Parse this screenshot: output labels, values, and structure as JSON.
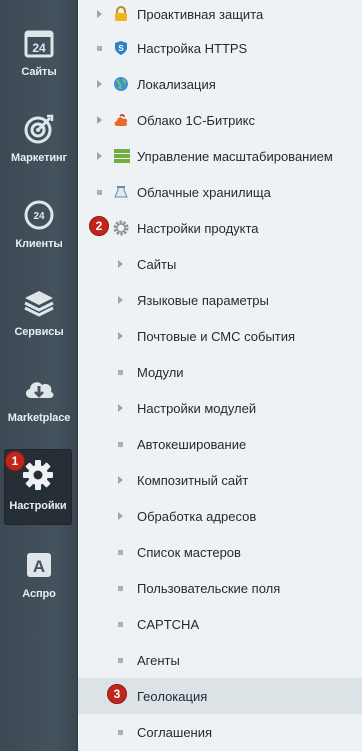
{
  "sidebar": {
    "items": [
      {
        "label": "Сайты",
        "icon": "sites-24-icon"
      },
      {
        "label": "Маркетинг",
        "icon": "target-icon"
      },
      {
        "label": "Клиенты",
        "icon": "clients-24-icon"
      },
      {
        "label": "Сервисы",
        "icon": "layers-icon"
      },
      {
        "label": "Marketplace",
        "icon": "cloud-download-icon"
      },
      {
        "label": "Настройки",
        "icon": "gear-icon",
        "badge": "1"
      },
      {
        "label": "Аспро",
        "icon": "aspro-a-icon"
      }
    ]
  },
  "menu": {
    "items": [
      {
        "label": "Проактивная защита"
      },
      {
        "label": "Настройка HTTPS"
      },
      {
        "label": "Локализация"
      },
      {
        "label": "Облако 1С-Битрикс"
      },
      {
        "label": "Управление масштабированием"
      },
      {
        "label": "Облачные хранилища"
      },
      {
        "label": "Настройки продукта",
        "badge": "2"
      },
      {
        "label": "Сайты"
      },
      {
        "label": "Языковые параметры"
      },
      {
        "label": "Почтовые и СМС события"
      },
      {
        "label": "Модули"
      },
      {
        "label": "Настройки модулей"
      },
      {
        "label": "Автокеширование"
      },
      {
        "label": "Композитный сайт"
      },
      {
        "label": "Обработка адресов"
      },
      {
        "label": "Список мастеров"
      },
      {
        "label": "Пользовательские поля"
      },
      {
        "label": "CAPTCHA"
      },
      {
        "label": "Агенты"
      },
      {
        "label": "Геолокация",
        "badge": "3"
      },
      {
        "label": "Соглашения"
      }
    ]
  },
  "colors": {
    "badge": "#c0261c",
    "rail": "#44525d",
    "highlight": "#dce3e7"
  }
}
